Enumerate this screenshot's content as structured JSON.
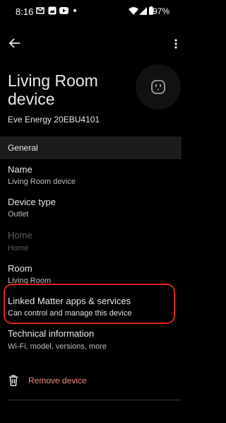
{
  "status_bar": {
    "time": "8:16",
    "battery": "97%"
  },
  "device": {
    "name_line1": "Living Room",
    "name_line2": "device",
    "model": "Eve Energy 20EBU4101"
  },
  "section_general": "General",
  "rows": {
    "name": {
      "title": "Name",
      "value": "Living Room device"
    },
    "device_type": {
      "title": "Device type",
      "value": "Outlet"
    },
    "home": {
      "title": "Home",
      "value": "Home"
    },
    "room": {
      "title": "Room",
      "value": "Living Room"
    },
    "linked": {
      "title": "Linked Matter apps & services",
      "value": "Can control and manage this device"
    },
    "technical": {
      "title": "Technical information",
      "value": "Wi-Fi, model, versions, more"
    }
  },
  "remove_label": "Remove device",
  "colors": {
    "accent_remove": "#f28b82",
    "highlight": "#e0211b",
    "background": "#000000"
  }
}
